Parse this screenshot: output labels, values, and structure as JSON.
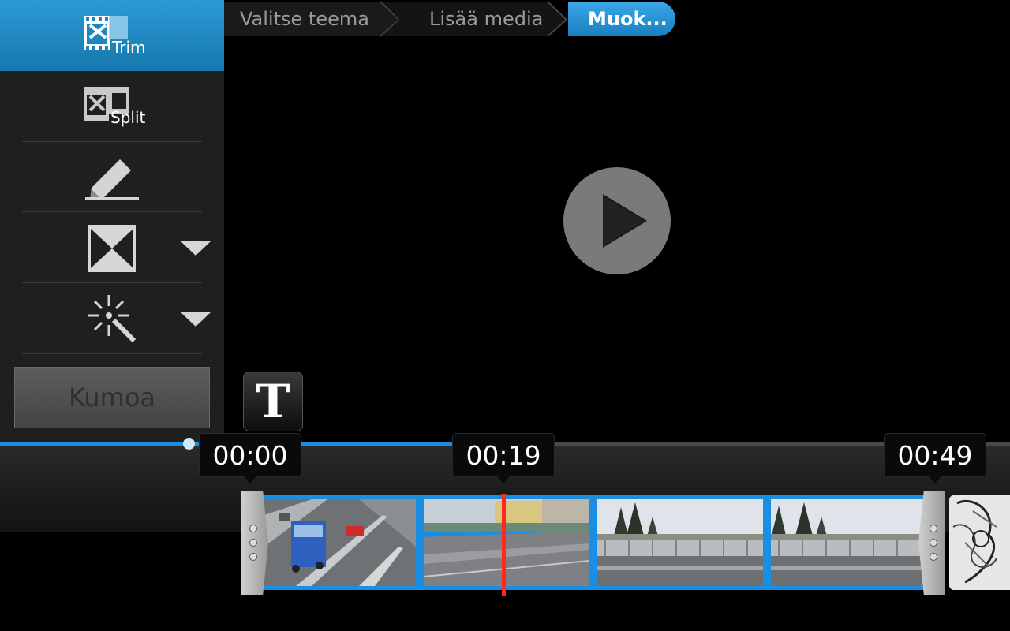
{
  "sidebar": {
    "tools": [
      {
        "name": "trim",
        "label": "Trim",
        "icon": "trim-icon",
        "active": true
      },
      {
        "name": "split",
        "label": "Split",
        "icon": "split-icon",
        "active": false
      },
      {
        "name": "edit",
        "label": "",
        "icon": "pencil-icon",
        "active": false
      },
      {
        "name": "transition",
        "label": "",
        "icon": "transition-icon",
        "active": false
      },
      {
        "name": "effect",
        "label": "",
        "icon": "magic-wand-icon",
        "active": false
      }
    ],
    "undo_label": "Kumoa"
  },
  "breadcrumb": {
    "steps": [
      "Valitse teema",
      "Lisää media",
      "Muok..."
    ],
    "active_index": 2
  },
  "preview": {
    "play_icon": "play-icon"
  },
  "text_tool": {
    "label": "T",
    "icon": "text-icon"
  },
  "timeline": {
    "progress_fraction": 0.49,
    "start_time": "00:00",
    "current_time": "00:19",
    "end_time": "00:49"
  },
  "colors": {
    "accent": "#1c8ee0",
    "active_tool": "#1f86c4",
    "playhead": "#ff2a1a"
  }
}
